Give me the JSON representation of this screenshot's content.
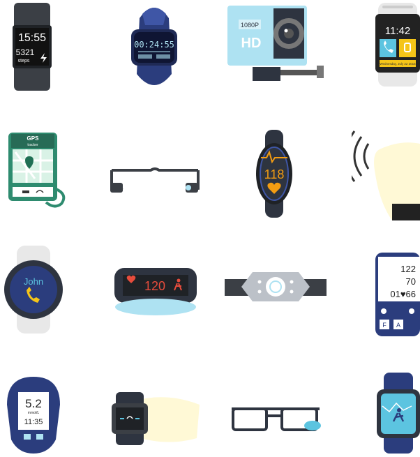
{
  "icons": [
    {
      "name": "fitness-band-icon",
      "time": "15:55",
      "steps": "5321",
      "steps_unit": "steps"
    },
    {
      "name": "smart-watch-timer-icon",
      "time": "00:24:55"
    },
    {
      "name": "action-camera-icon",
      "resolution": "1080P",
      "quality": "HD"
    },
    {
      "name": "smartwatch-phone-icon",
      "time": "11:42",
      "date_line": "Wednesday, July 22 2015"
    },
    {
      "name": "gps-tracker-icon",
      "title": "GPS",
      "subtitle": "tracker"
    },
    {
      "name": "smart-glasses-icon"
    },
    {
      "name": "heart-rate-band-icon",
      "bpm": "118"
    },
    {
      "name": "gesture-hand-icon"
    },
    {
      "name": "round-watch-call-icon",
      "caller": "John"
    },
    {
      "name": "heart-band-icon",
      "bpm": "120"
    },
    {
      "name": "clip-tracker-icon"
    },
    {
      "name": "blood-pressure-monitor-icon",
      "systolic": "122",
      "diastolic": "70",
      "pulse": "01♥66",
      "btn_f": "F",
      "btn_a": "A"
    },
    {
      "name": "glucose-meter-icon",
      "reading": "5.2",
      "unit": "mmol/L",
      "time": "11:35"
    },
    {
      "name": "wrist-band-hand-icon"
    },
    {
      "name": "vr-glasses-icon"
    },
    {
      "name": "running-watch-icon"
    }
  ],
  "colors": {
    "dark": "#2e3440",
    "navy": "#2b3d7d",
    "sky": "#aee2f2",
    "orange": "#f39c12",
    "green": "#2e8b6f",
    "red": "#e74c3c",
    "yellow": "#fff9d6"
  }
}
